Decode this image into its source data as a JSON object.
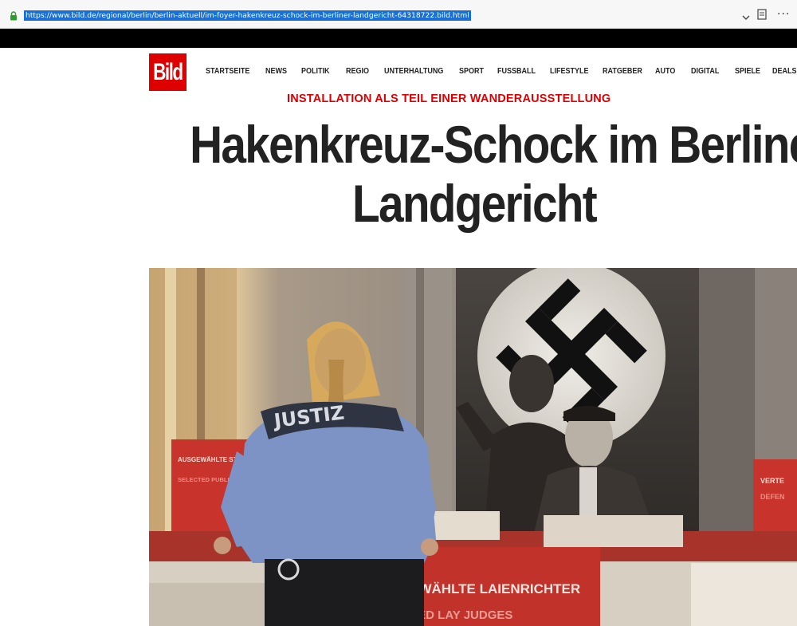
{
  "browser": {
    "url": "https://www.bild.de/regional/berlin/berlin-aktuell/im-foyer-hakenkreuz-schock-im-berliner-landgericht-64318722.bild.html",
    "more_icon": "···"
  },
  "site": {
    "logo_text": "Bild",
    "brand_color": "#de0000",
    "nav": [
      "STARTSEITE",
      "NEWS",
      "POLITIK",
      "REGIO",
      "UNTERHALTUNG",
      "SPORT",
      "FUSSBALL",
      "LIFESTYLE",
      "RATGEBER",
      "AUTO",
      "DIGITAL",
      "SPIELE",
      "DEALS"
    ]
  },
  "article": {
    "kicker": "INSTALLATION ALS TEIL EINER WANDERAUSSTELLUNG",
    "headline_line1": "Hakenkreuz-Schock im Berliner",
    "headline_line2": "Landgericht"
  },
  "photo": {
    "uniform_text": "JUSTIZ",
    "sign_left_de": "AUSGEWÄHLTE STAATSANWÄLTE",
    "sign_left_en": "SELECTED PUBLIC PROSECUTORS",
    "sign_center_de": "AUSGEWÄHLTE LAIENRICHTER",
    "sign_center_en": "SELECTED LAY JUDGES",
    "sign_right_de": "VERTE",
    "sign_right_en": "DEFEN"
  }
}
